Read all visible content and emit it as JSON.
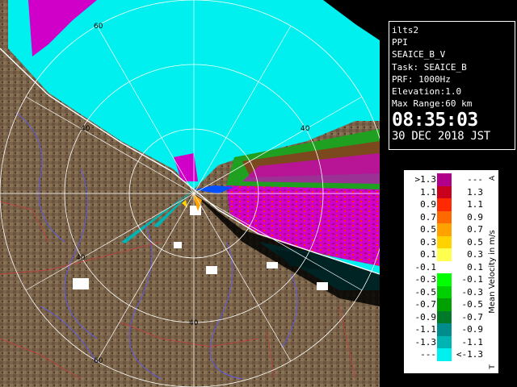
{
  "info": {
    "station": "ilts2",
    "mode": "PPI",
    "scan": "SEAICE_B_V",
    "task": "Task: SEAICE_B",
    "prf": "PRF: 1000Hz",
    "elevation": "Elevation:1.0",
    "max_range": "Max Range:60 km",
    "time": "08:35:03",
    "date": "30 DEC 2018 JST"
  },
  "range_ring_labels": [
    "40",
    "60",
    "40",
    "40",
    "40",
    "60"
  ],
  "legend": {
    "title": "Mean Velocity in m/s",
    "top_marker": "A",
    "bottom_marker": "T",
    "rows": [
      {
        "lo": ">1.3",
        "hi": "---",
        "color": "#b0008a"
      },
      {
        "lo": "1.1",
        "hi": "1.3",
        "color": "#c8001e"
      },
      {
        "lo": "0.9",
        "hi": "1.1",
        "color": "#ff2a00"
      },
      {
        "lo": "0.7",
        "hi": "0.9",
        "color": "#ff6a00"
      },
      {
        "lo": "0.5",
        "hi": "0.7",
        "color": "#ffa200"
      },
      {
        "lo": "0.3",
        "hi": "0.5",
        "color": "#ffd200"
      },
      {
        "lo": "0.1",
        "hi": "0.3",
        "color": "#ffff50"
      },
      {
        "lo": "-0.1",
        "hi": "0.1",
        "color": "#ffffff"
      },
      {
        "lo": "-0.3",
        "hi": "-0.1",
        "color": "#00ff00"
      },
      {
        "lo": "-0.5",
        "hi": "-0.3",
        "color": "#00d000"
      },
      {
        "lo": "-0.7",
        "hi": "-0.5",
        "color": "#00a000"
      },
      {
        "lo": "-0.9",
        "hi": "-0.7",
        "color": "#007a28"
      },
      {
        "lo": "-1.1",
        "hi": "-0.9",
        "color": "#008c8c"
      },
      {
        "lo": "-1.3",
        "hi": "-1.1",
        "color": "#00b4b4"
      },
      {
        "lo": "---",
        "hi": "<-1.3",
        "color": "#00f0f0"
      }
    ]
  },
  "colors": {
    "terrain": "#7a634a",
    "terrain_dark": "#5a4632",
    "sea_ice_approach": "#00f0f0",
    "sea_ice_recede": "#d000c8",
    "coast_roads": "#c04040",
    "rivers": "#5a5aff",
    "grid": "#ffffff"
  }
}
